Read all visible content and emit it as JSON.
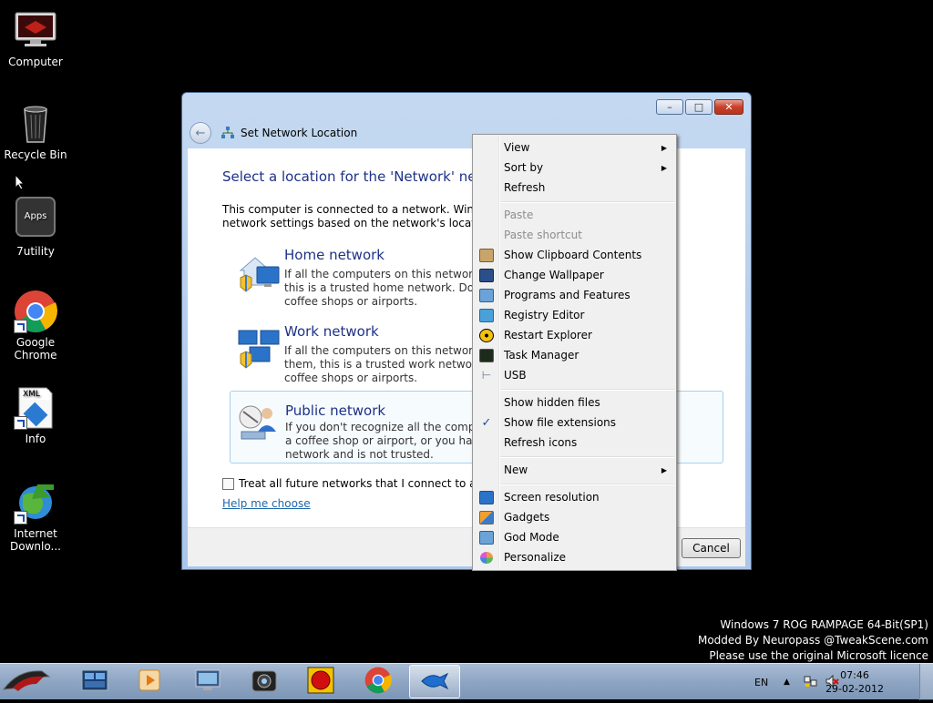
{
  "desktop": {
    "icons": [
      {
        "label": "Computer",
        "icon": "computer-icon"
      },
      {
        "label": "Recycle Bin",
        "icon": "recycle-bin-icon"
      },
      {
        "label": "7utility",
        "icon": "apps-icon",
        "icon_text": "Apps"
      },
      {
        "label": "Google\nChrome",
        "icon": "chrome-icon"
      },
      {
        "label": "Info",
        "icon": "xml-file-icon",
        "icon_text": "XML"
      },
      {
        "label": "Internet\nDownlo...",
        "icon": "internet-download-manager-icon"
      }
    ]
  },
  "window": {
    "title": "Set Network Location",
    "heading": "Select a location for the 'Network' netw",
    "intro_line1": "This computer is connected to a network. Windows",
    "intro_line2": "network settings based on the network's location.",
    "options": [
      {
        "title": "Home network",
        "lines": [
          "If all the computers on this network are",
          "this is a trusted home network.  Don't c",
          "coffee shops or airports."
        ],
        "icon": "home-network-icon"
      },
      {
        "title": "Work network",
        "lines": [
          "If all the computers on this network are",
          "them, this is a trusted work network.  D",
          "coffee shops or airports."
        ],
        "icon": "work-network-icon"
      },
      {
        "title": "Public network",
        "lines": [
          "If you don't recognize all the computer",
          "a coffee shop or airport, or you have m",
          "network and is not trusted."
        ],
        "icon": "public-network-icon",
        "selected": true
      }
    ],
    "checkbox_label": "Treat all future networks that I connect to as publ",
    "checkbox_checked": false,
    "help_link": "Help me choose",
    "cancel_label": "Cancel",
    "caption": {
      "minimize": "–",
      "maximize": "□",
      "close": "✕"
    }
  },
  "context_menu": {
    "items": [
      {
        "label": "View",
        "submenu": true
      },
      {
        "label": "Sort by",
        "submenu": true
      },
      {
        "label": "Refresh"
      },
      {
        "separator": true
      },
      {
        "label": "Paste",
        "disabled": true
      },
      {
        "label": "Paste shortcut",
        "disabled": true
      },
      {
        "label": "Show Clipboard Contents",
        "icon": "clipboard-icon"
      },
      {
        "label": "Change Wallpaper",
        "icon": "wallpaper-icon"
      },
      {
        "label": "Programs and Features",
        "icon": "programs-icon"
      },
      {
        "label": "Registry Editor",
        "icon": "registry-icon"
      },
      {
        "label": "Restart Explorer",
        "icon": "radiation-icon"
      },
      {
        "label": "Task Manager",
        "icon": "task-manager-icon"
      },
      {
        "label": "USB",
        "icon": "usb-icon"
      },
      {
        "separator": true
      },
      {
        "label": "Show hidden files"
      },
      {
        "label": "Show file extensions",
        "checked": true
      },
      {
        "label": "Refresh icons"
      },
      {
        "separator": true
      },
      {
        "label": "New",
        "submenu": true
      },
      {
        "separator": true
      },
      {
        "label": "Screen resolution",
        "icon": "display-icon"
      },
      {
        "label": "Gadgets",
        "icon": "gadgets-icon"
      },
      {
        "label": "God Mode",
        "icon": "god-mode-icon"
      },
      {
        "label": "Personalize",
        "icon": "personalize-icon"
      }
    ]
  },
  "watermark": {
    "line1": "Windows 7 ROG RAMPAGE 64-Bit(SP1)",
    "line2": "Modded By Neuropass @TweakScene.com",
    "line3": "Please use the original Microsoft licence"
  },
  "taskbar": {
    "apps": [
      {
        "icon": "explorer-icon"
      },
      {
        "icon": "media-player-icon"
      },
      {
        "icon": "remote-desktop-icon"
      },
      {
        "icon": "camera-icon"
      },
      {
        "icon": "record-icon"
      },
      {
        "icon": "chrome-icon"
      },
      {
        "icon": "network-wizard-icon",
        "active": true
      }
    ],
    "language": "EN",
    "time": "07:46",
    "date": "29-02-2012"
  }
}
